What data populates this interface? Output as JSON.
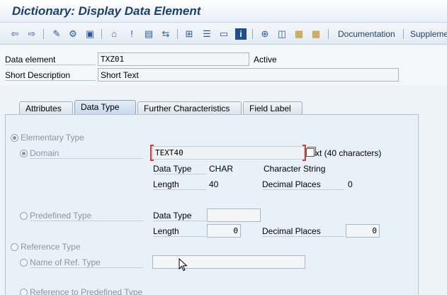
{
  "window": {
    "title": "Dictionary: Display Data Element"
  },
  "toolbar": {
    "icons": [
      "back-arrow-icon",
      "forward-arrow-icon",
      "other-object-icon",
      "display-change-icon",
      "activate-icon",
      "check-icon",
      "where-used-icon",
      "object-list-icon",
      "display-object-list-icon",
      "navigation-window-icon",
      "hierarchy-icon",
      "info-icon",
      "technical-settings-icon",
      "create-icon",
      "copy-icon",
      "delete-icon"
    ],
    "documentation_label": "Documentation",
    "supplement_label": "Suppleme"
  },
  "header": {
    "data_element_label": "Data element",
    "data_element_value": "TXZ01",
    "status": "Active",
    "short_description_label": "Short Description",
    "short_description_value": "Short Text"
  },
  "tabs": [
    {
      "label": "Attributes"
    },
    {
      "label": "Data Type"
    },
    {
      "label": "Further Characteristics"
    },
    {
      "label": "Field Label"
    }
  ],
  "data_type_tab": {
    "elementary_type_label": "Elementary Type",
    "domain_label": "Domain",
    "domain_value": "TEXT40",
    "domain_description": "xt (40 characters)",
    "domain_data_type_label": "Data Type",
    "domain_data_type_value": "CHAR",
    "domain_data_type_desc": "Character String",
    "domain_length_label": "Length",
    "domain_length_value": "40",
    "domain_decimal_label": "Decimal Places",
    "domain_decimal_value": "0",
    "predefined_type_label": "Predefined Type",
    "predef_data_type_label": "Data Type",
    "predef_data_type_value": "",
    "predef_length_label": "Length",
    "predef_length_value": "0",
    "predef_decimal_label": "Decimal Places",
    "predef_decimal_value": "0",
    "reference_type_label": "Reference Type",
    "ref_name_label": "Name of Ref. Type",
    "ref_name_value": "",
    "ref_predefined_label": "Reference to Predefined Type"
  }
}
